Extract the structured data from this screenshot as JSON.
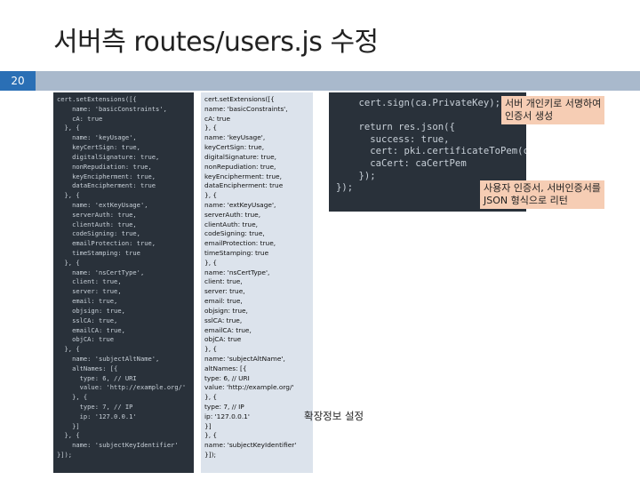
{
  "slide": {
    "title": "서버측 routes/users.js 수정",
    "page_number": "20"
  },
  "code_left": {
    "lines": [
      "cert.setExtensions([{",
      "    name: 'basicConstraints',",
      "    cA: true",
      "  }, {",
      "    name: 'keyUsage',",
      "    keyCertSign: true,",
      "    digitalSignature: true,",
      "    nonRepudiation: true,",
      "    keyEncipherment: true,",
      "    dataEncipherment: true",
      "  }, {",
      "    name: 'extKeyUsage',",
      "    serverAuth: true,",
      "    clientAuth: true,",
      "    codeSigning: true,",
      "    emailProtection: true,",
      "    timeStamping: true",
      "  }, {",
      "    name: 'nsCertType',",
      "    client: true,",
      "    server: true,",
      "    email: true,",
      "    objsign: true,",
      "    sslCA: true,",
      "    emailCA: true,",
      "    objCA: true",
      "  }, {",
      "    name: 'subjectAltName',",
      "    altNames: [{",
      "      type: 6, // URI",
      "      value: 'http://example.org/'",
      "    }, {",
      "      type: 7, // IP",
      "      ip: '127.0.0.1'",
      "    }]",
      "  }, {",
      "    name: 'subjectKeyIdentifier'",
      "}]);"
    ]
  },
  "code_plain": {
    "lines": [
      "cert.setExtensions([{",
      "name: 'basicConstraints',",
      "cA: true",
      "}, {",
      "name: 'keyUsage',",
      "keyCertSign: true,",
      "digitalSignature: true,",
      "nonRepudiation: true,",
      "keyEncipherment: true,",
      "dataEncipherment: true",
      "}, {",
      "name: 'extKeyUsage',",
      "serverAuth: true,",
      "clientAuth: true,",
      "codeSigning: true,",
      "emailProtection: true,",
      "timeStamping: true",
      "}, {",
      "name: 'nsCertType',",
      "client: true,",
      "server: true,",
      "email: true,",
      "objsign: true,",
      "sslCA: true,",
      "emailCA: true,",
      "objCA: true",
      "}, {",
      "name: 'subjectAltName',",
      "altNames: [{",
      "type: 6, // URI",
      "value: 'http://example.org/'",
      "}, {",
      "type: 7, // IP",
      "ip: '127.0.0.1'",
      "}]",
      "}, {",
      "name: 'subjectKeyIdentifier'",
      "}]);"
    ]
  },
  "code_right": {
    "lines": [
      "    cert.sign(ca.PrivateKey);",
      "",
      "    return res.json({",
      "      success: true,",
      "      cert: pki.certificateToPem(cert),",
      "      caCert: caCertPem",
      "    });",
      "});"
    ]
  },
  "callouts": {
    "sign": "서버 개인키로 서명하여\n인증서 생성",
    "json": "사용자 인증서, 서버인증서를\nJSON 형식으로 리턴",
    "ext": "확장정보 설정"
  }
}
